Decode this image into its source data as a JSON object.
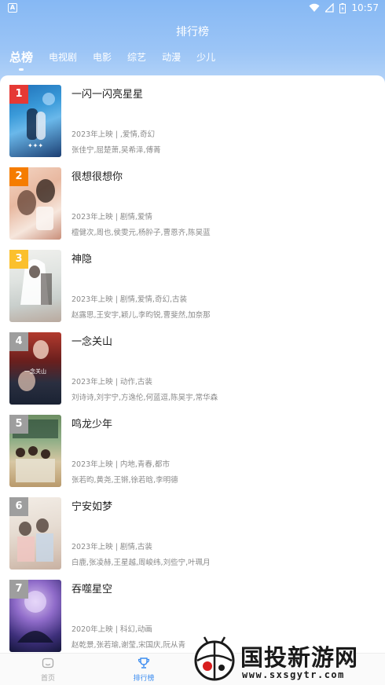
{
  "status": {
    "time": "10:57",
    "left_icon": "A"
  },
  "header": {
    "title": "排行榜"
  },
  "tabs": [
    {
      "label": "总榜",
      "active": true
    },
    {
      "label": "电视剧"
    },
    {
      "label": "电影"
    },
    {
      "label": "综艺"
    },
    {
      "label": "动漫"
    },
    {
      "label": "少儿"
    }
  ],
  "items": [
    {
      "rank": "1",
      "title": "一闪一闪亮星星",
      "meta": "2023年上映 | ,爱情,奇幻",
      "cast": "张佳宁,屈楚萧,吴希泽,傅菁",
      "rank_color": "#e53935"
    },
    {
      "rank": "2",
      "title": "很想很想你",
      "meta": "2023年上映 | 剧情,爱情",
      "cast": "檀健次,周也,侯雯元,杨肸子,曹恩齐,陈昊蓝",
      "rank_color": "#f57c00"
    },
    {
      "rank": "3",
      "title": "神隐",
      "meta": "2023年上映 | 剧情,爱情,奇幻,古装",
      "cast": "赵露思,王安宇,颖儿,李昀锐,曹斐然,加奈那",
      "rank_color": "#fbc02d"
    },
    {
      "rank": "4",
      "title": "一念关山",
      "meta": "2023年上映 | 动作,古装",
      "cast": "刘诗诗,刘宇宁,方逸伦,何蓝逗,陈昊宇,常华森",
      "rank_color": "#9e9e9e"
    },
    {
      "rank": "5",
      "title": "鸣龙少年",
      "meta": "2023年上映 | 内地,青春,都市",
      "cast": "张若昀,黄尧,王锵,徐若晗,李明德",
      "rank_color": "#9e9e9e"
    },
    {
      "rank": "6",
      "title": "宁安如梦",
      "meta": "2023年上映 | 剧情,古装",
      "cast": "白鹿,张凌赫,王星越,周峻纬,刘些宁,叶珮月",
      "rank_color": "#9e9e9e"
    },
    {
      "rank": "7",
      "title": "吞噬星空",
      "meta": "2020年上映 | 科幻,动画",
      "cast": "赵乾景,张若瑜,谢莹,宋国庆,阮从青",
      "rank_color": "#9e9e9e"
    }
  ],
  "bottom_nav": [
    {
      "label": "首页",
      "icon": "home-icon"
    },
    {
      "label": "排行榜",
      "icon": "trophy-icon",
      "active": true
    }
  ],
  "watermark": {
    "text": "国投新游网",
    "url": "www.sxsgytr.com"
  }
}
